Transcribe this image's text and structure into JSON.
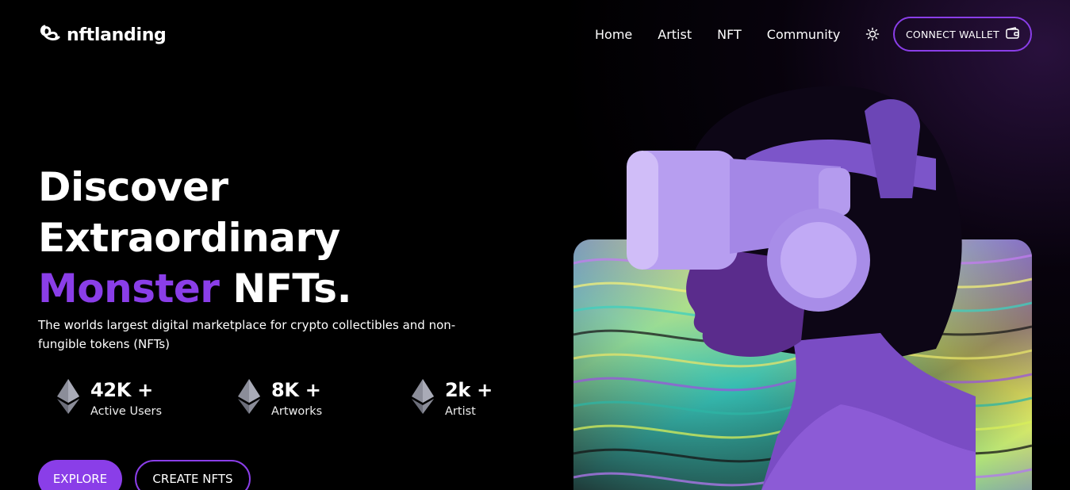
{
  "brand": {
    "name": "nftlanding",
    "logo_icon": "swirl-logo-icon"
  },
  "nav": {
    "links": [
      "Home",
      "Artist",
      "NFT",
      "Community"
    ],
    "theme_icon": "sun-icon",
    "wallet_button": {
      "label": "CONNECT WALLET",
      "icon": "wallet-icon"
    }
  },
  "hero": {
    "line1": "Discover",
    "line2": "Extraordinary",
    "line3_accent": "Monster",
    "line3_rest": " NFTs.",
    "description": "The worlds largest digital marketplace for crypto collectibles and non-fungible tokens (NFTs)",
    "stats": [
      {
        "value": "42K +",
        "label": "Active Users",
        "icon": "ethereum-icon"
      },
      {
        "value": "8K +",
        "label": "Artworks",
        "icon": "ethereum-icon"
      },
      {
        "value": "2k +",
        "label": "Artist",
        "icon": "ethereum-icon"
      }
    ],
    "buttons": {
      "explore": "EXPLORE",
      "create": "CREATE NFTS"
    }
  },
  "colors": {
    "accent": "#8a3ee8",
    "background": "#000000"
  }
}
